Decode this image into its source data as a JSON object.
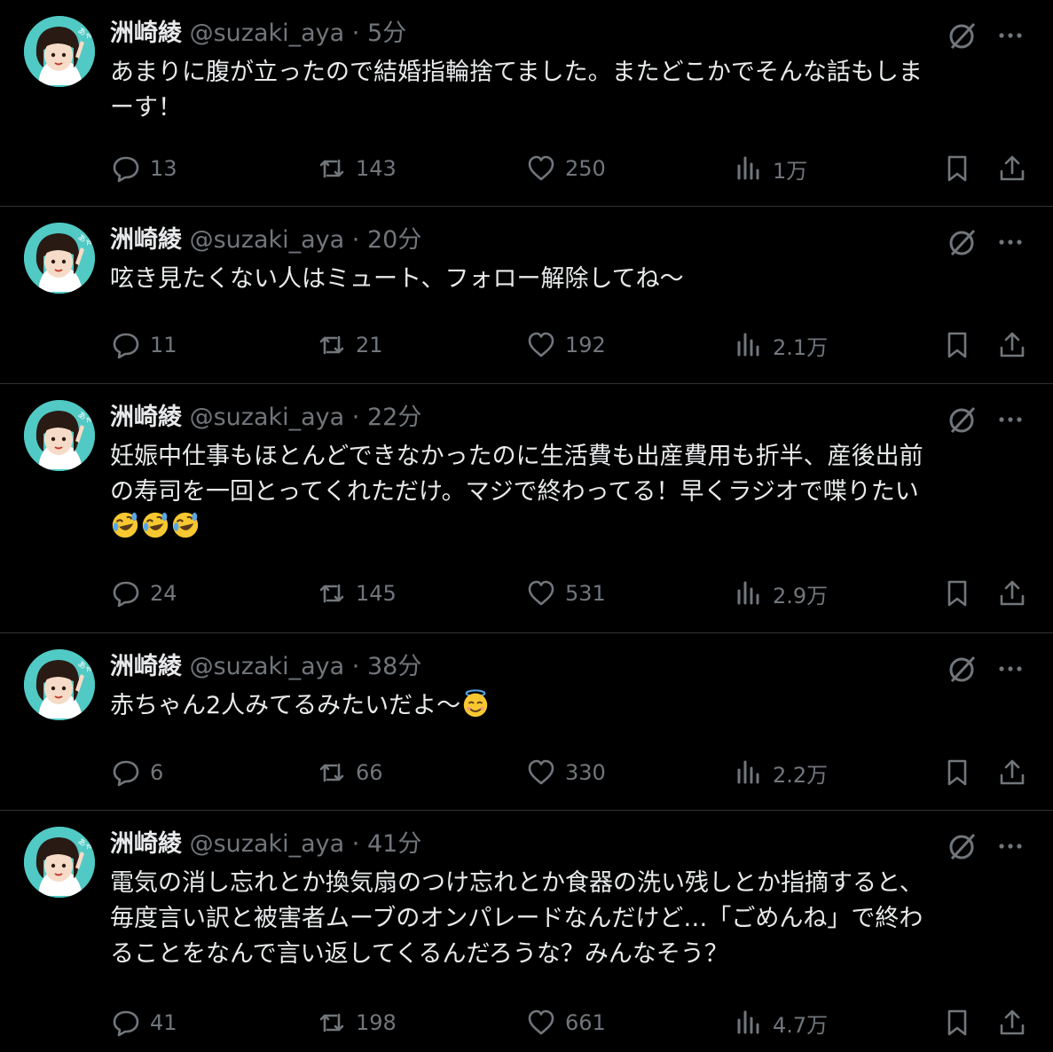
{
  "colors": {
    "background": "#000000",
    "text": "#e7e9ea",
    "muted": "#71767b",
    "divider": "#2f3336",
    "avatar_bg": "#51c9c4"
  },
  "tweets": [
    {
      "name": "洲崎綾",
      "handle": "@suzaki_aya",
      "dot": "·",
      "time": "5分",
      "text": "あまりに腹が立ったので結婚指輪捨てました。またどこかでそんな話もしま\nーす！",
      "replies": "13",
      "retweets": "143",
      "likes": "250",
      "views": "1万"
    },
    {
      "name": "洲崎綾",
      "handle": "@suzaki_aya",
      "dot": "·",
      "time": "20分",
      "text": "呟き見たくない人はミュート、フォロー解除してね〜",
      "replies": "11",
      "retweets": "21",
      "likes": "192",
      "views": "2.1万"
    },
    {
      "name": "洲崎綾",
      "handle": "@suzaki_aya",
      "dot": "·",
      "time": "22分",
      "text": "妊娠中仕事もほとんどできなかったのに生活費も出産費用も折半、産後出前\nの寿司を一回とってくれただけ。マジで終わってる！早くラジオで喋りたい\n",
      "emoji": [
        "rolling-on-floor-laughing",
        "rolling-on-floor-laughing",
        "rolling-on-floor-laughing"
      ],
      "replies": "24",
      "retweets": "145",
      "likes": "531",
      "views": "2.9万"
    },
    {
      "name": "洲崎綾",
      "handle": "@suzaki_aya",
      "dot": "·",
      "time": "38分",
      "text": "赤ちゃん2人みてるみたいだよ〜",
      "emoji": [
        "smiling-face-with-halo"
      ],
      "replies": "6",
      "retweets": "66",
      "likes": "330",
      "views": "2.2万"
    },
    {
      "name": "洲崎綾",
      "handle": "@suzaki_aya",
      "dot": "·",
      "time": "41分",
      "text": "電気の消し忘れとか換気扇のつけ忘れとか食器の洗い残しとか指摘すると、\n毎度言い訳と被害者ムーブのオンパレードなんだけど…「ごめんね」で終わ\nることをなんで言い返してくるんだろうな？みんなそう？",
      "replies": "41",
      "retweets": "198",
      "likes": "661",
      "views": "4.7万"
    }
  ]
}
